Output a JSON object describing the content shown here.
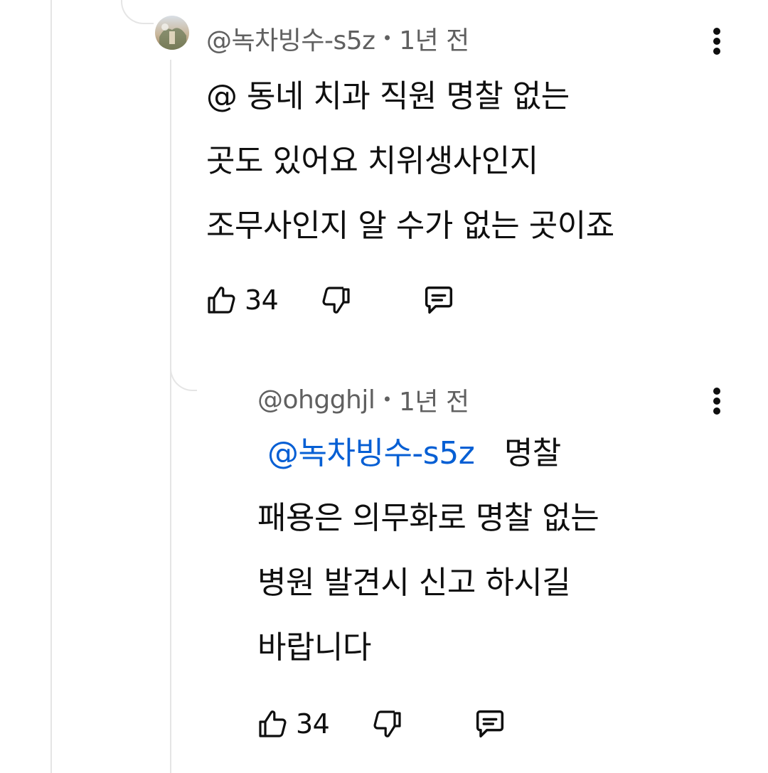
{
  "comments": [
    {
      "author": "@녹차빙수-s5z",
      "time": "1년 전",
      "body_lines": [
        "@ 동네 치과 직원 명찰 없는",
        "곳도 있어요 치위생사인지",
        "조무사인지 알 수가 없는 곳이죠"
      ],
      "like_count": "34"
    },
    {
      "author": "@ohgghjl",
      "time": "1년 전",
      "mention": "@녹차빙수-s5z",
      "first_line_rest": "명찰",
      "body_lines": [
        "패용은 의무화로 명찰 없는",
        "병원 발견시 신고 하시길",
        "바랍니다"
      ],
      "like_count": "34"
    }
  ],
  "separator": "•",
  "icons": {
    "like": "thumbs-up-icon",
    "dislike": "thumbs-down-icon",
    "reply": "reply-comment-icon",
    "menu": "more-vertical-icon"
  },
  "colors": {
    "text": "#0f0f0f",
    "meta": "#606060",
    "mention": "#065fd4",
    "thread": "#e5e5e5"
  }
}
